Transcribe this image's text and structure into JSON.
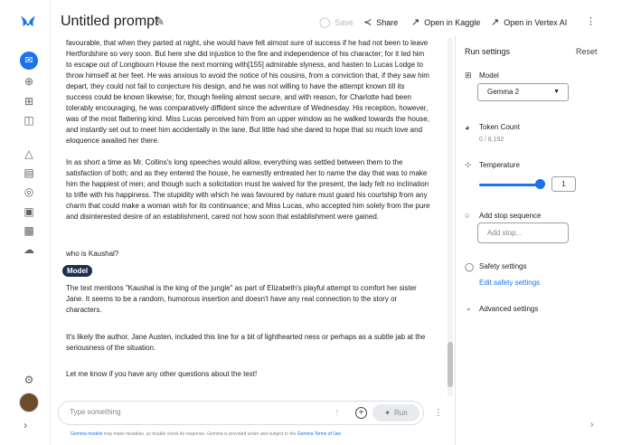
{
  "header": {
    "title": "Untitled prompt",
    "save_label": "Save",
    "share_label": "Share",
    "kaggle_label": "Open in Kaggle",
    "vertex_label": "Open in Vertex AI"
  },
  "chat": {
    "para1": "favourable, that when they parted at night, she would have felt almost sure of success if he had not been to leave Hertfordshire so very soon. But here she did injustice to the fire and independence of his character; for it led him to escape out of Longbourn House the next morning with[155] admirable slyness, and hasten to Lucas Lodge to throw himself at her feet. He was anxious to avoid the notice of his cousins, from a conviction that, if they saw him depart, they could not fail to conjecture his design, and he was not willing to have the attempt known till its success could be known likewise; for, though feeling almost secure, and with reason, for Charlotte had been tolerably encouraging, he was comparatively diffident since the adventure of Wednesday. His reception, however, was of the most flattering kind. Miss Lucas perceived him from an upper window as he walked towards the house, and instantly set out to meet him accidentally in the lane. But little had she dared to hope that so much love and eloquence awaited her there.",
    "para2": "In as short a time as Mr. Collins's long speeches would allow, everything was settled between them to the satisfaction of both; and as they entered the house, he earnestly entreated her to name the day that was to make him the happiest of men; and though such a solicitation must be waived for the present, the lady felt no inclination to trifle with his happiness. The stupidity with which he was favoured by nature must guard his courtship from any charm that could make a woman wish for its continuance; and Miss Lucas, who accepted him solely from the pure and disinterested desire of an establishment, cared not how soon that establishment were gained.",
    "user_question": "who is Kaushal?",
    "model_label": "Model",
    "response1": "The text mentions \"Kaushal is the king of the jungle\" as part of Elizabeth's playful attempt to comfort her sister Jane. It seems to be a random, humorous insertion and doesn't have any real connection to the story or characters.",
    "response2": "It's likely the author, Jane Austen, included this line for a bit of lighthearted ness or perhaps as a subtle jab at the seriousness of the situation.",
    "response3": "Let me know if you have any other questions about the text!"
  },
  "prompt": {
    "placeholder": "Type something",
    "run_label": "Run"
  },
  "disclaimer": {
    "link1": "Gemma models",
    "mid": " may make mistakes, so double check its response. Gemma is provided under and subject to the ",
    "link2": "Gemma Terms of Use"
  },
  "settings": {
    "title": "Run settings",
    "reset_label": "Reset",
    "model_label": "Model",
    "model_value": "Gemma 2",
    "token_label": "Token Count",
    "token_value": "0 / 8,192",
    "temperature_label": "Temperature",
    "temperature_value": "1",
    "temperature_fraction": 1.0,
    "stop_label": "Add stop sequence",
    "stop_placeholder": "Add stop...",
    "safety_label": "Safety settings",
    "safety_link": "Edit safety settings",
    "advanced_label": "Advanced settings"
  },
  "icons": {
    "rail": [
      "gemini-logo",
      "chat-icon",
      "add-icon",
      "gallery-icon",
      "library-icon",
      "school-icon",
      "docs-icon",
      "lightbulb-icon",
      "ticket-icon",
      "forum-icon",
      "cloud-icon",
      "settings-icon",
      "avatar",
      "chevron-right-icon"
    ]
  },
  "colors": {
    "accent": "#1a73e8",
    "model_chip": "#1e2e4f"
  }
}
